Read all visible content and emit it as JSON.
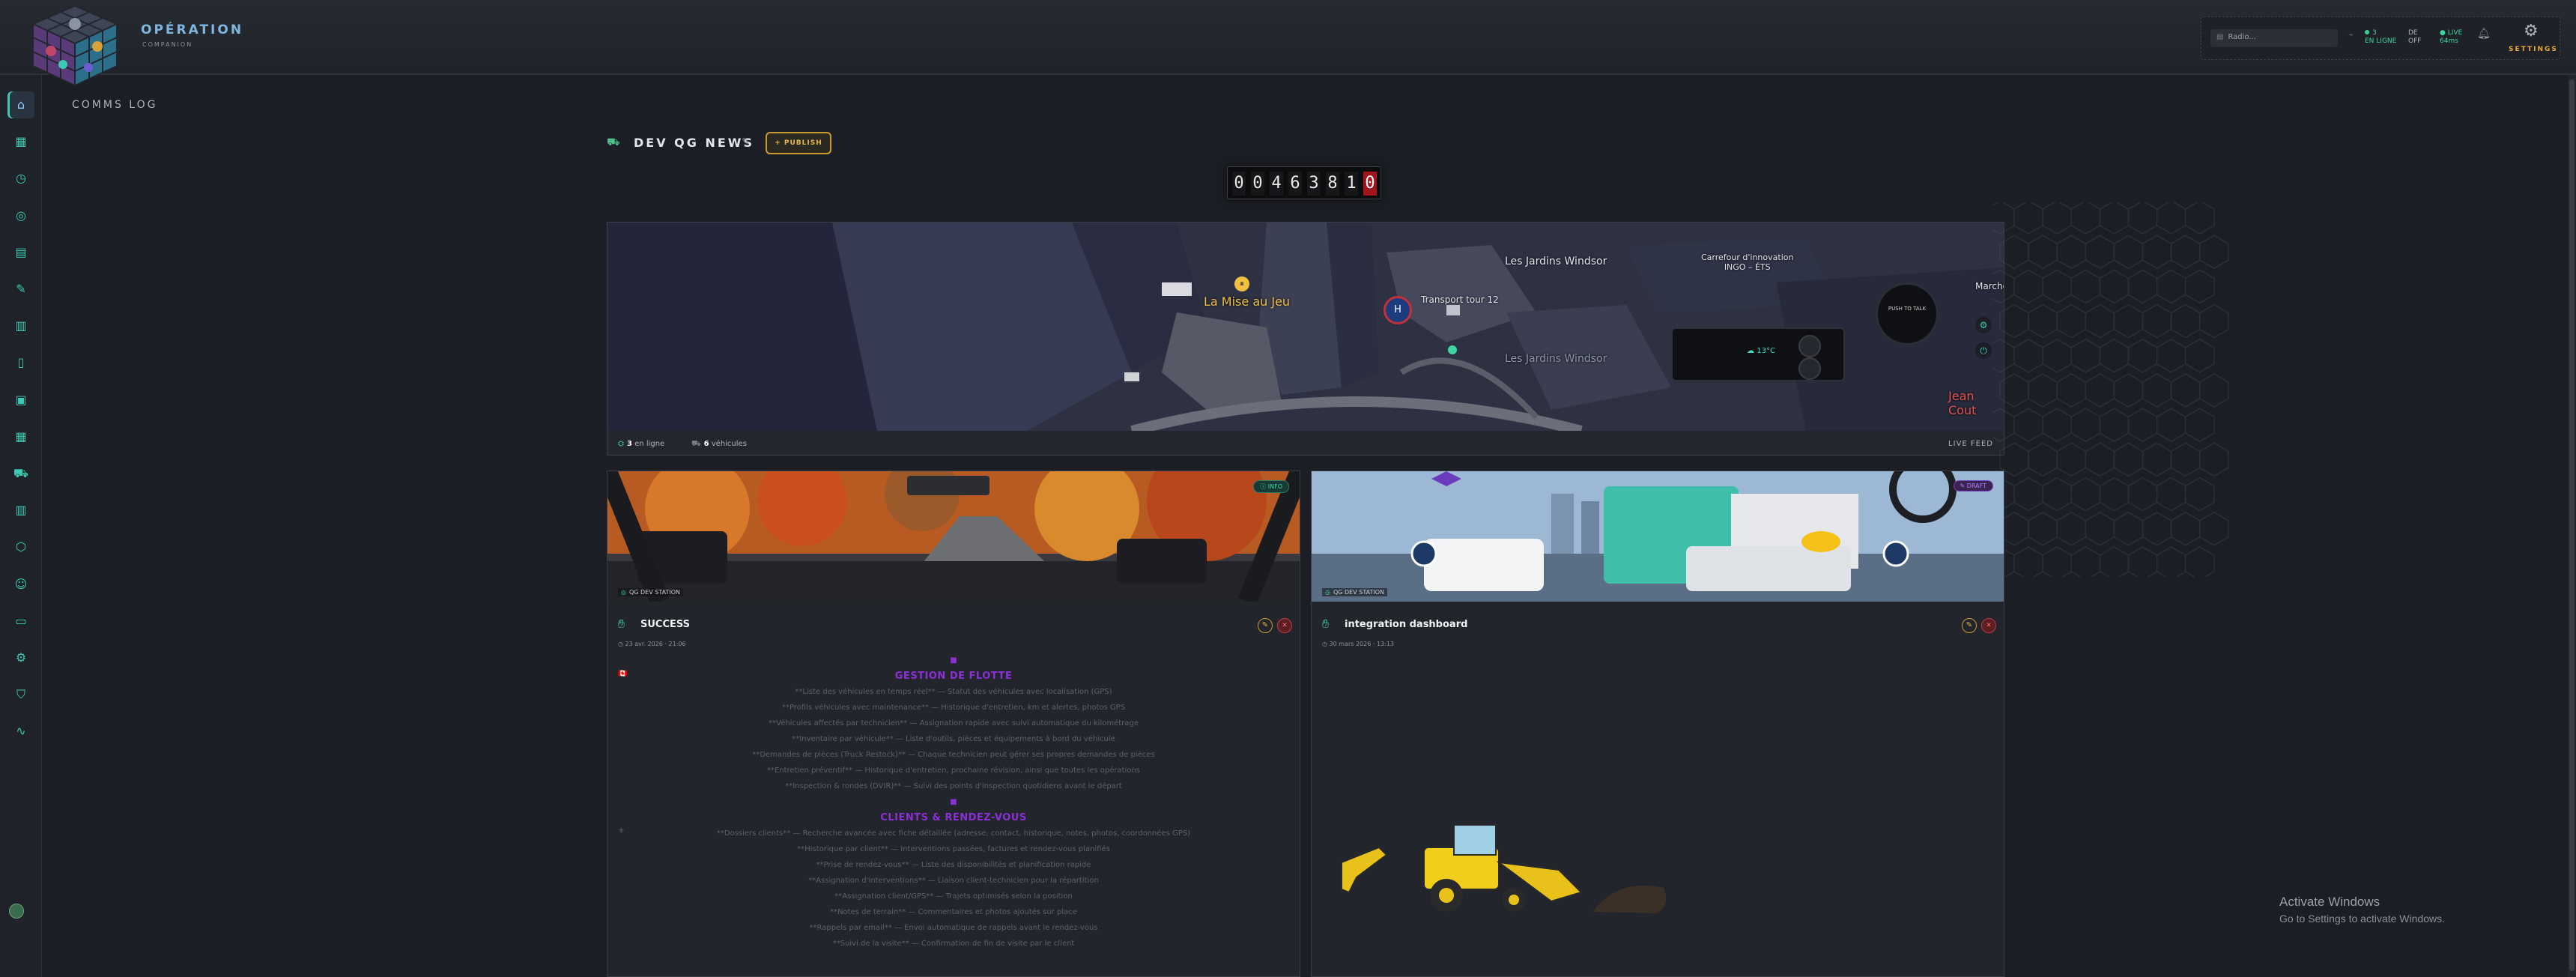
{
  "brand": {
    "title": "OPÉRATION",
    "subtitle": "COMPANION"
  },
  "status": {
    "radio_placeholder": "Radio...",
    "online_count": "3",
    "online_label": "EN LIGNE",
    "duty_label": "DE",
    "duty_state": "OFF",
    "live_label": "LIVE",
    "live_value": "64ms",
    "settings_label": "SETTINGS"
  },
  "sidebar": {
    "items": [
      {
        "name": "home",
        "icon": "⌂"
      },
      {
        "name": "dashboard",
        "icon": "▦"
      },
      {
        "name": "history",
        "icon": "◷"
      },
      {
        "name": "target",
        "icon": "◎"
      },
      {
        "name": "clipboard",
        "icon": "▤"
      },
      {
        "name": "wrench",
        "icon": "✎"
      },
      {
        "name": "map",
        "icon": "▥"
      },
      {
        "name": "document",
        "icon": "▯"
      },
      {
        "name": "contacts",
        "icon": "▣"
      },
      {
        "name": "calendar",
        "icon": "▦"
      },
      {
        "name": "truck",
        "icon": "⛟"
      },
      {
        "name": "building",
        "icon": "▥"
      },
      {
        "name": "package",
        "icon": "⬡"
      },
      {
        "name": "users",
        "icon": "☺"
      },
      {
        "name": "chat",
        "icon": "▭"
      },
      {
        "name": "settings",
        "icon": "⚙"
      },
      {
        "name": "shield",
        "icon": "⛉"
      },
      {
        "name": "analytics",
        "icon": "∿"
      }
    ]
  },
  "page": {
    "title": "COMMS LOG"
  },
  "news": {
    "title": "DEV QG NEWS",
    "publish_label": "+ PUBLISH"
  },
  "counter": {
    "digits": [
      "0",
      "0",
      "4",
      "6",
      "3",
      "8",
      "1",
      "0"
    ]
  },
  "map": {
    "labels": {
      "mise": "La Mise au Jeu",
      "jardins": "Les Jardins Windsor",
      "jardins2": "Les Jardins Windsor",
      "carrefour": "Carrefour d'innovation",
      "carrefour2": "INGO – ÉTS",
      "transport": "Transport tour 12",
      "marche": "Marché",
      "jean": "Jean Cout"
    },
    "temperature": "13°C",
    "handset_text": "PUSH TO TALK",
    "online": "3",
    "online_label": "en ligne",
    "vehicles": "6",
    "vehicles_label": "véhicules",
    "live_feed": "LIVE FEED"
  },
  "posts": [
    {
      "source": "QG DEV STATION",
      "badge": "INFO",
      "title": "SUCCESS",
      "date": "23 avr. 2026 · 21:06",
      "section1": "GESTION DE FLOTTE",
      "lines1": [
        "**Liste des véhicules en temps réel** — Statut des véhicules avec localisation (GPS)",
        "**Profils véhicules avec maintenance** — Historique d'entretien, km et alertes, photos GPS",
        "**Véhicules affectés par technicien** — Assignation rapide avec suivi automatique du kilométrage",
        "**Inventaire par véhicule** — Liste d'outils, pièces et équipements à bord du véhicule",
        "**Demandes de pièces (Truck Restock)** — Chaque technicien peut gérer ses propres demandes de pièces",
        "**Entretien préventif** — Historique d'entretien, prochaine révision, ainsi que toutes les opérations",
        "**Inspection & rondes (DVIR)** — Suivi des points d'inspection quotidiens avant le départ"
      ],
      "section2": "CLIENTS & RENDEZ-VOUS",
      "lines2": [
        "**Dossiers clients** — Recherche avancée avec fiche détaillée (adresse, contact, historique, notes, photos, coordonnées GPS)",
        "**Historique par client** — Interventions passées, factures et rendez-vous planifiés",
        "**Prise de rendez-vous** — Liste des disponibilités et planification rapide",
        "**Assignation d'interventions** — Liaison client-technicien pour la répartition",
        "**Assignation client/GPS** — Trajets optimisés selon la position",
        "**Notes de terrain** — Commentaires et photos ajoutés sur place",
        "**Rappels par email** — Envoi automatique de rappels avant le rendez-vous",
        "**Suivi de la visite** — Confirmation de fin de visite par le client"
      ]
    },
    {
      "source": "QG DEV STATION",
      "badge": "DRAFT",
      "title": "integration dashboard",
      "date": "30 mars 2026 · 13:13"
    }
  ],
  "watermark": {
    "title": "Activate Windows",
    "subtitle": "Go to Settings to activate Windows."
  },
  "colors": {
    "accent": "#3ec9b5",
    "gold": "#e8b84a",
    "purple": "#8b2fd6",
    "danger": "#c03a44"
  }
}
